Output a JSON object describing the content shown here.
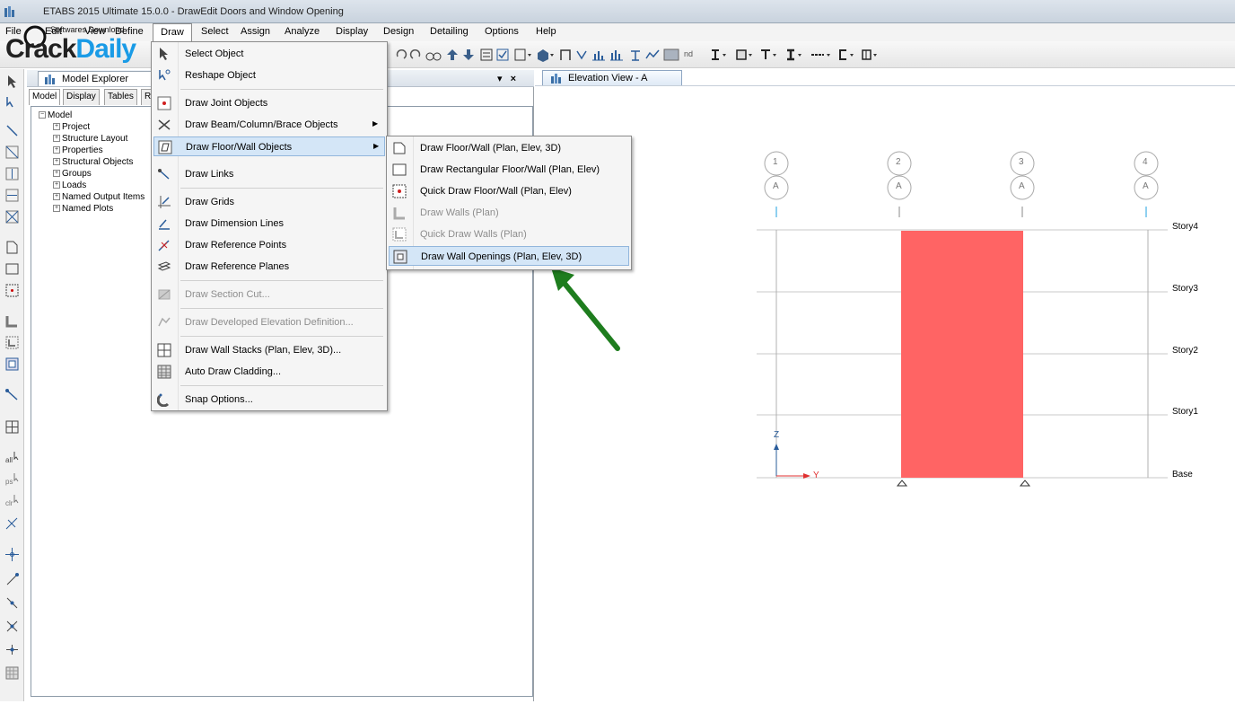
{
  "window": {
    "title": "ETABS 2015 Ultimate 15.0.0 - DrawEdit Doors and Window Opening"
  },
  "watermark": {
    "big_text": "CrackDaily",
    "small_text": "Softwares Download"
  },
  "menubar": {
    "items": [
      "File",
      "Edit",
      "View",
      "Define",
      "Draw",
      "Select",
      "Assign",
      "Analyze",
      "Display",
      "Design",
      "Detailing",
      "Options",
      "Help"
    ]
  },
  "toolbar": {
    "nd_label": "nd",
    "icons": [
      "undo-icon",
      "redo-icon",
      "glasses-icon",
      "move-up-icon",
      "move-down-icon",
      "properties-icon",
      "check-icon",
      "view-icon",
      "3d-icon",
      "frame-icon",
      "joint-icon",
      "chart-icon",
      "bar-chart-icon",
      "section-icon",
      "diagram-icon",
      "grid-icon",
      "steel-i-icon",
      "box-icon",
      "tee-icon",
      "column-icon",
      "line-icon",
      "channel-icon",
      "panel-icon"
    ]
  },
  "explorer": {
    "title": "Model Explorer",
    "pin_glyph": "▾",
    "close_glyph": "×",
    "tabs": [
      "Model",
      "Display",
      "Tables",
      "R"
    ],
    "tree": {
      "root": "Model",
      "children": [
        "Project",
        "Structure Layout",
        "Properties",
        "Structural Objects",
        "Groups",
        "Loads",
        "Named Output Items",
        "Named Plots"
      ]
    }
  },
  "elevation_view": {
    "tab_title": "Elevation View - A",
    "grid_numbers": [
      "1",
      "2",
      "3",
      "4"
    ],
    "grid_letter": "A",
    "stories": [
      "Story4",
      "Story3",
      "Story2",
      "Story1",
      "Base"
    ],
    "axis_z": "Z",
    "axis_y": "Y",
    "wall_color": "#ff6464"
  },
  "draw_menu": {
    "items": [
      {
        "label": "Select Object",
        "icon": "select-arrow-icon",
        "submenu": false,
        "disabled": false
      },
      {
        "label": "Reshape Object",
        "icon": "reshape-icon",
        "submenu": false,
        "disabled": false
      },
      {
        "label": "Draw Joint Objects",
        "icon": "joint-icon",
        "submenu": false,
        "disabled": false
      },
      {
        "label": "Draw Beam/Column/Brace Objects",
        "icon": "beam-icon",
        "submenu": true,
        "disabled": false
      },
      {
        "label": "Draw Floor/Wall Objects",
        "icon": "floor-wall-icon",
        "submenu": true,
        "disabled": false,
        "highlighted": true
      },
      {
        "label": "Draw Links",
        "icon": "link-icon",
        "submenu": false,
        "disabled": false
      },
      {
        "label": "Draw Grids",
        "icon": "grid-draw-icon",
        "submenu": false,
        "disabled": false
      },
      {
        "label": "Draw Dimension Lines",
        "icon": "dimension-icon",
        "submenu": false,
        "disabled": false
      },
      {
        "label": "Draw Reference Points",
        "icon": "reference-point-icon",
        "submenu": false,
        "disabled": false
      },
      {
        "label": "Draw Reference Planes",
        "icon": "reference-plane-icon",
        "submenu": false,
        "disabled": false
      },
      {
        "label": "Draw Section Cut...",
        "icon": "section-cut-icon",
        "submenu": false,
        "disabled": true
      },
      {
        "label": "Draw Developed Elevation Definition...",
        "icon": "developed-elevation-icon",
        "submenu": false,
        "disabled": true
      },
      {
        "label": "Draw Wall Stacks (Plan, Elev, 3D)...",
        "icon": "wall-stack-icon",
        "submenu": false,
        "disabled": false
      },
      {
        "label": "Auto Draw Cladding...",
        "icon": "cladding-icon",
        "submenu": false,
        "disabled": false
      },
      {
        "label": "Snap Options...",
        "icon": "snap-icon",
        "submenu": false,
        "disabled": false
      }
    ]
  },
  "floor_wall_submenu": {
    "items": [
      {
        "label": "Draw Floor/Wall (Plan, Elev, 3D)",
        "icon": "floor-wall-draw-icon",
        "disabled": false
      },
      {
        "label": "Draw Rectangular Floor/Wall (Plan, Elev)",
        "icon": "rectangle-icon",
        "disabled": false
      },
      {
        "label": "Quick Draw Floor/Wall (Plan, Elev)",
        "icon": "quick-draw-icon",
        "disabled": false
      },
      {
        "label": "Draw Walls (Plan)",
        "icon": "wall-plan-icon",
        "disabled": true
      },
      {
        "label": "Quick Draw Walls (Plan)",
        "icon": "quick-wall-icon",
        "disabled": true
      },
      {
        "label": "Draw Wall Openings (Plan, Elev, 3D)",
        "icon": "wall-opening-icon",
        "disabled": false,
        "highlighted": true
      }
    ]
  },
  "annotation": {
    "arrow_color": "#1e7d1e"
  }
}
